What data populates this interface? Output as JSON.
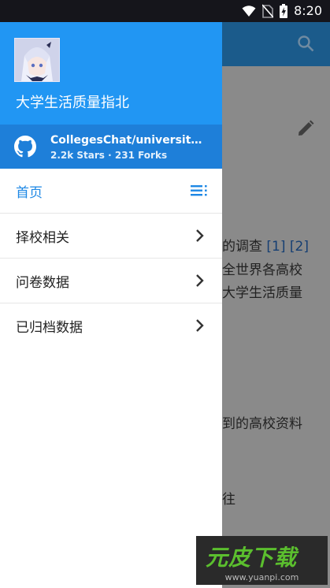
{
  "status_bar": {
    "time": "8:20"
  },
  "drawer": {
    "title": "大学生活质量指北",
    "repo": {
      "name": "CollegesChat/university-in…",
      "stats": "2.2k Stars · 231 Forks"
    },
    "items": [
      {
        "label": "首页",
        "active": true
      },
      {
        "label": "择校相关"
      },
      {
        "label": "问卷数据"
      },
      {
        "label": "已归档数据"
      }
    ]
  },
  "background": {
    "line1_text": "的调查 ",
    "line1_ref1": "[1]",
    "line1_ref2": "[2]",
    "line2": "全世界各高校",
    "line3": "大学生活质量",
    "line4": "到的高校资料",
    "line5": "往"
  },
  "watermark": {
    "logo": "元皮下载",
    "url": "www.yuanpi.com"
  },
  "colors": {
    "drawer_header": "#2196f3",
    "repo_bar": "#1e7fd9",
    "active_item": "#1e88e5"
  }
}
